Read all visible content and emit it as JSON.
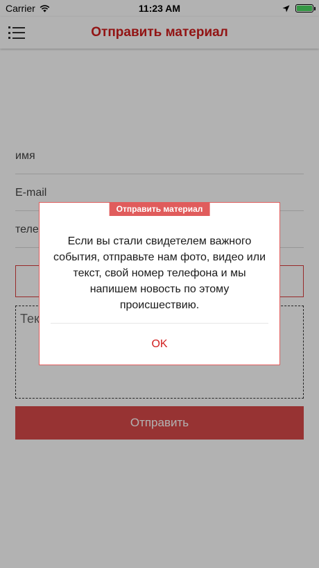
{
  "status_bar": {
    "carrier": "Carrier",
    "time": "11:23 AM",
    "battery_level": 1.0
  },
  "nav": {
    "title": "Отправить материал"
  },
  "form": {
    "name_placeholder": "имя",
    "email_placeholder": "E-mail",
    "phone_placeholder": "теле",
    "text_placeholder": "Тек",
    "submit_label": "Отправить"
  },
  "dialog": {
    "title": "Отправить материал",
    "message": "Если вы стали свидетелем важного события, отправьте нам фото, видео или текст, свой номер телефона и мы напишем новость по этому происшествию.",
    "ok_label": "OK"
  },
  "colors": {
    "accent": "#d11e1e",
    "badge": "#e05c5c",
    "button": "#d94a4a"
  }
}
